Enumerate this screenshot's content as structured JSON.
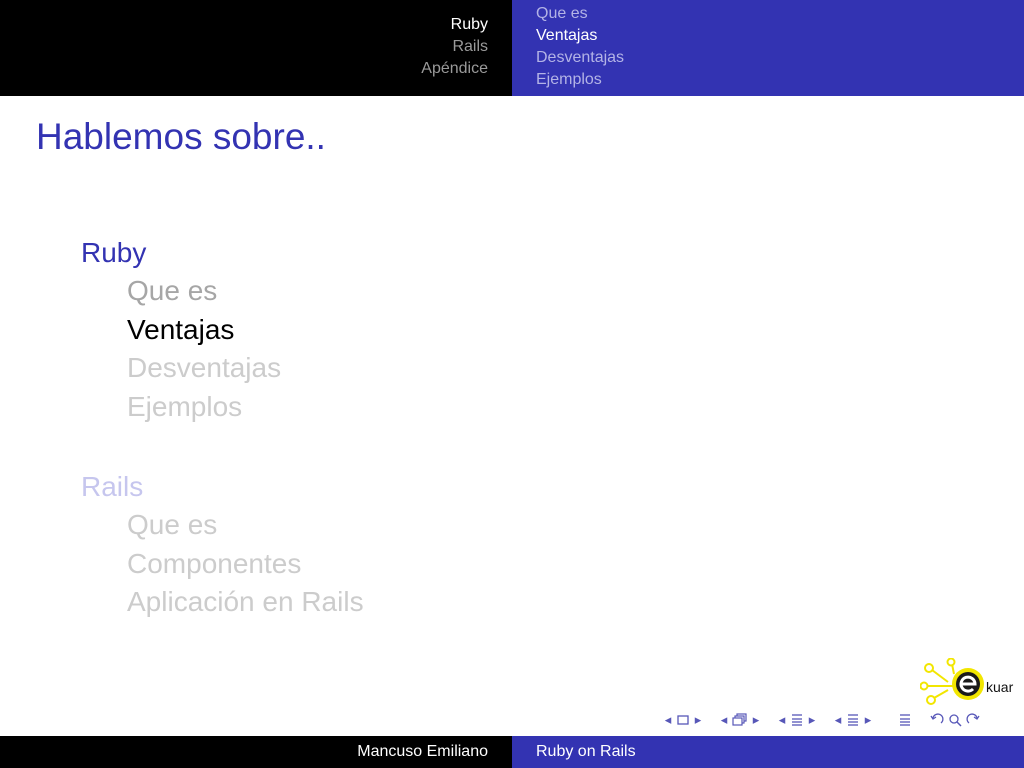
{
  "header": {
    "sections": [
      "Ruby",
      "Rails",
      "Apéndice"
    ],
    "current_section": "Ruby",
    "subsections": [
      "Que es",
      "Ventajas",
      "Desventajas",
      "Ejemplos"
    ],
    "current_subsection": "Ventajas"
  },
  "frame": {
    "title": "Hablemos sobre.."
  },
  "outline": {
    "ruby": {
      "label": "Ruby",
      "items": [
        "Que es",
        "Ventajas",
        "Desventajas",
        "Ejemplos"
      ]
    },
    "rails": {
      "label": "Rails",
      "items": [
        "Que es",
        "Componentes",
        "Aplicación en Rails"
      ]
    }
  },
  "logo": {
    "text": "kuar",
    "letter": "e"
  },
  "footer": {
    "author": "Mancuso Emiliano",
    "title": "Ruby on Rails"
  },
  "colors": {
    "accent": "#3333b2",
    "header_left": "#000000",
    "logo_yellow": "#f2e600"
  },
  "nav_icons": [
    "nav-frame-prev-icon",
    "nav-frame-icon",
    "nav-frame-next-icon",
    "nav-subsection-prev-icon",
    "nav-subsection-icon",
    "nav-subsection-next-icon",
    "nav-section-prev-icon",
    "nav-section-icon",
    "nav-section-next-icon",
    "nav-doc-prev-icon",
    "nav-doc-icon",
    "nav-doc-next-icon",
    "nav-align-icon",
    "nav-back-icon",
    "nav-search-icon",
    "nav-forward-icon"
  ]
}
